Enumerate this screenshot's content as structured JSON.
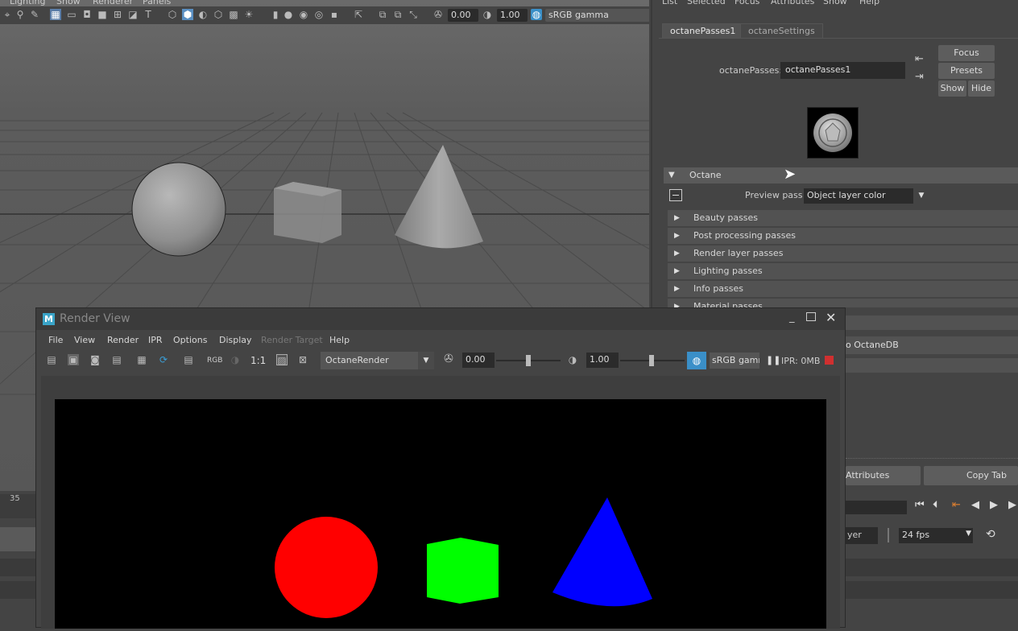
{
  "viewport": {
    "menu": [
      "Lighting",
      "Show",
      "Renderer",
      "Panels"
    ],
    "exposure": "0.00",
    "gamma": "1.00",
    "colorspace": "sRGB gamma",
    "timeline_mark": "35"
  },
  "attribute_editor": {
    "menu": [
      "List",
      "Selected",
      "Focus",
      "Attributes",
      "Show",
      "Help"
    ],
    "tabs": [
      "octanePasses1",
      "octaneSettings"
    ],
    "node_label": "octanePasses:",
    "node_value": "octanePasses1",
    "buttons": {
      "focus": "Focus",
      "presets": "Presets",
      "show": "Show",
      "hide": "Hide"
    },
    "octane_section": "Octane",
    "preview_pass_label": "Preview pass",
    "preview_pass_value": "Object layer color",
    "sections": [
      "Beauty passes",
      "Post processing passes",
      "Render layer passes",
      "Lighting passes",
      "Info passes",
      "Material passes"
    ],
    "octanedb": "o OctaneDB",
    "bottom_buttons": {
      "attributes": "Attributes",
      "copy_tab": "Copy Tab"
    },
    "layer_label": "yer",
    "fps": "24 fps"
  },
  "render_view": {
    "title": "Render View",
    "menu": [
      "File",
      "View",
      "Render",
      "IPR",
      "Options",
      "Display",
      "Render Target",
      "Help"
    ],
    "rgb": "RGB",
    "ratio": "1:1",
    "renderer": "OctaneRender",
    "exposure": "0.00",
    "gamma": "1.00",
    "colorspace": "sRGB gamm",
    "ipr_status": "IPR: 0MB"
  },
  "colors": {
    "sphere": "#ff0000",
    "cube": "#00ff00",
    "cone": "#0000ff",
    "accent": "#3a8fc8"
  }
}
